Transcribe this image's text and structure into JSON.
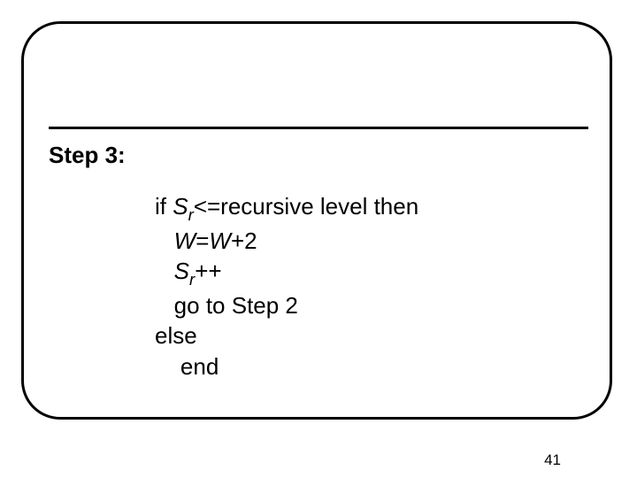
{
  "step_label": "Step 3:",
  "code": {
    "if_kw": "if ",
    "S": "S",
    "r": "r",
    "cond_rest": "<=recursive level then",
    "W1": "W",
    "eq": "=",
    "W2": "W",
    "plus2": "+2",
    "pp": "++",
    "goto": "go to Step 2",
    "else_kw": "else",
    "end_kw": "end"
  },
  "page_number": "41"
}
